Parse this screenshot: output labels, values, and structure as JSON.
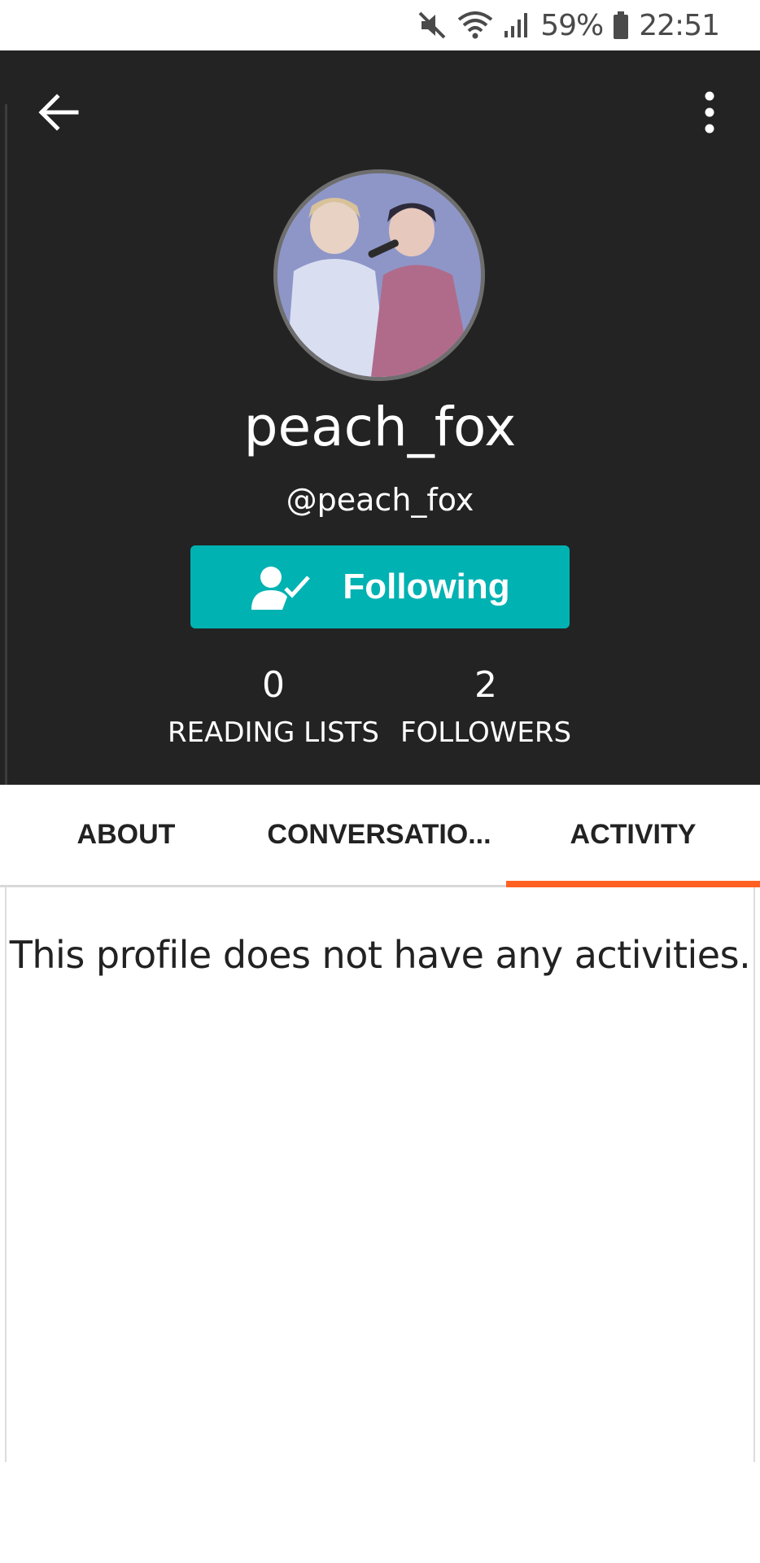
{
  "status_bar": {
    "battery": "59%",
    "time": "22:51",
    "icons": [
      "mute-icon",
      "wifi-icon",
      "signal-icon",
      "battery-icon"
    ]
  },
  "header": {
    "back_icon": "arrow-left-icon",
    "more_icon": "more-vertical-icon",
    "display_name": "peach_fox",
    "username": "@peach_fox",
    "follow_button": {
      "label": "Following",
      "icon": "user-check-icon"
    },
    "stats": [
      {
        "value": "0",
        "label": "READING LISTS"
      },
      {
        "value": "2",
        "label": "FOLLOWERS"
      }
    ]
  },
  "tabs": [
    {
      "label": "ABOUT"
    },
    {
      "label": "CONVERSATIO..."
    },
    {
      "label": "ACTIVITY",
      "active": true
    }
  ],
  "content": {
    "empty_message": "This profile does not have any activities."
  },
  "colors": {
    "header_bg": "#232323",
    "follow_button": "#00b2b2",
    "tab_indicator": "#ff6122"
  }
}
